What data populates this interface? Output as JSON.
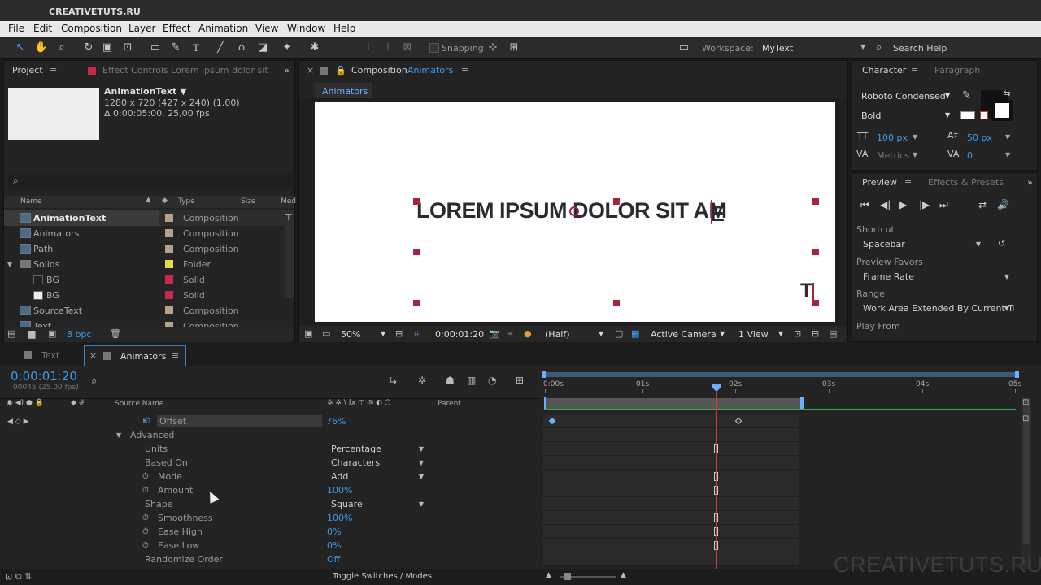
{
  "app": {
    "title": "CREATIVETUTS.RU",
    "watermark": "CREATIVETUTS.RU"
  },
  "menu": [
    "File",
    "Edit",
    "Composition",
    "Layer",
    "Effect",
    "Animation",
    "View",
    "Window",
    "Help"
  ],
  "toolbar": {
    "snapping": "Snapping",
    "workspace_label": "Workspace:",
    "workspace_value": "MyText",
    "search_placeholder": "Search Help"
  },
  "project": {
    "tab": "Project",
    "effect_controls_tab": "Effect Controls Lorem ipsum dolor sit",
    "item_name": "AnimationText ▼",
    "item_dims": "1280 x 720  (427 x 240) (1,00)",
    "item_duration": "Δ 0:00:05:00, 25,00 fps",
    "col_name": "Name",
    "col_type": "Type",
    "col_size": "Size",
    "col_med": "Med",
    "items": [
      {
        "name": "AnimationText",
        "type": "Composition",
        "color": "#b5a285"
      },
      {
        "name": "Animators",
        "type": "Composition",
        "color": "#b5a285"
      },
      {
        "name": "Path",
        "type": "Composition",
        "color": "#b5a285"
      },
      {
        "name": "Solids",
        "type": "Folder",
        "color": "#e6d84a"
      },
      {
        "name": "BG",
        "type": "Solid",
        "color": "#c8284a"
      },
      {
        "name": "BG",
        "type": "Solid",
        "color": "#c8284a"
      },
      {
        "name": "SourceText",
        "type": "Composition",
        "color": "#b5a285"
      },
      {
        "name": "Text",
        "type": "Composition",
        "color": "#b5a285"
      }
    ],
    "bpc": "8 bpc"
  },
  "composition": {
    "tab_label": "Composition",
    "tab_name": "Animators",
    "sub_tab": "Animators",
    "canvas_text": "LOREM IPSUM DOLOR SIT AM",
    "canvas_last": "E",
    "canvas_corner": "T",
    "zoom": "50%",
    "timecode": "0:00:01:20",
    "resolution": "(Half)",
    "camera": "Active Camera",
    "views": "1 View"
  },
  "character": {
    "tab": "Character",
    "tab2": "Paragraph",
    "font": "Roboto Condensed",
    "style": "Bold",
    "size": "100 px",
    "leading": "50 px",
    "kerning": "Metrics",
    "tracking": "0"
  },
  "preview": {
    "tab": "Preview",
    "tab2": "Effects & Presets",
    "shortcut_label": "Shortcut",
    "shortcut": "Spacebar",
    "favors_label": "Preview Favors",
    "favors": "Frame Rate",
    "range_label": "Range",
    "range": "Work Area Extended By Current Ti",
    "play_from_label": "Play From"
  },
  "timeline": {
    "tab_text": "Text",
    "tab_animators": "Animators",
    "timecode": "0:00:01:20",
    "frames": "00045 (25.00 fps)",
    "source_name": "Source Name",
    "parent": "Parent",
    "ruler": [
      "0:00s",
      "01s",
      "02s",
      "03s",
      "04s",
      "05s"
    ],
    "toggle": "Toggle Switches / Modes",
    "props": [
      {
        "label": "Offset",
        "value": "76%",
        "stopwatch": true,
        "indent": 196
      },
      {
        "label": "Advanced",
        "value": "",
        "stopwatch": false,
        "indent": 160
      },
      {
        "label": "Units",
        "value": "Percentage",
        "stopwatch": false,
        "indent": 178,
        "dropdown": true
      },
      {
        "label": "Based On",
        "value": "Characters",
        "stopwatch": false,
        "indent": 178,
        "dropdown": true
      },
      {
        "label": "Mode",
        "value": "Add",
        "stopwatch": true,
        "indent": 194,
        "dropdown": true
      },
      {
        "label": "Amount",
        "value": "100%",
        "stopwatch": true,
        "indent": 194
      },
      {
        "label": "Shape",
        "value": "Square",
        "stopwatch": false,
        "indent": 178,
        "dropdown": true
      },
      {
        "label": "Smoothness",
        "value": "100%",
        "stopwatch": true,
        "indent": 194
      },
      {
        "label": "Ease High",
        "value": "0%",
        "stopwatch": true,
        "indent": 194
      },
      {
        "label": "Ease Low",
        "value": "0%",
        "stopwatch": true,
        "indent": 194
      },
      {
        "label": "Randomize Order",
        "value": "Off",
        "stopwatch": false,
        "indent": 178
      }
    ]
  }
}
